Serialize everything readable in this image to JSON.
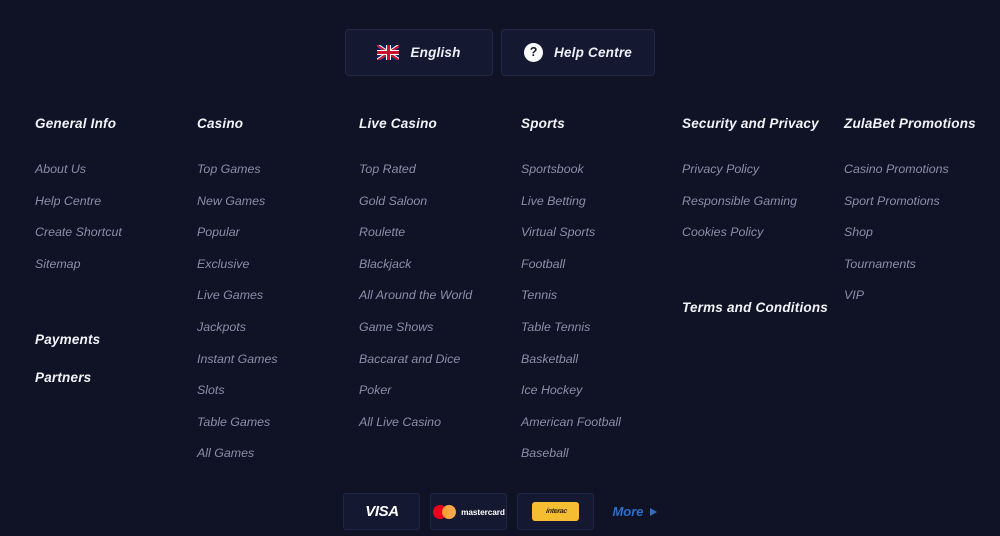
{
  "colors": {
    "background": "#101226",
    "panel": "#151831",
    "border": "#242845",
    "heading_text": "#f3f4f9",
    "link_text": "#8a8fa9",
    "accent_blue": "#2d6fc4",
    "gold": "#F5BE32"
  },
  "top_bar": {
    "language_button": {
      "label": "English",
      "icon": "uk-flag-icon"
    },
    "help_button": {
      "label": "Help Centre",
      "icon": "question-mark-icon"
    }
  },
  "columns": [
    {
      "heading": "General Info",
      "links": [
        "About Us",
        "Help Centre",
        "Create Shortcut",
        "Sitemap"
      ]
    },
    {
      "heading": "Casino",
      "links": [
        "Top Games",
        "New Games",
        "Popular",
        "Exclusive",
        "Live Games",
        "Jackpots",
        "Instant Games",
        "Slots",
        "Table Games",
        "All Games"
      ]
    },
    {
      "heading": "Live Casino",
      "links": [
        "Top Rated",
        "Gold Saloon",
        "Roulette",
        "Blackjack",
        "All Around the World",
        "Game Shows",
        "Baccarat and Dice",
        "Poker",
        "All Live Casino"
      ]
    },
    {
      "heading": "Sports",
      "links": [
        "Sportsbook",
        "Live Betting",
        "Virtual Sports",
        "Football",
        "Tennis",
        "Table Tennis",
        "Basketball",
        "Ice Hockey",
        "American Football",
        "Baseball"
      ]
    },
    {
      "heading": "Security and Privacy",
      "links": [
        "Privacy Policy",
        "Responsible Gaming",
        "Cookies Policy"
      ]
    },
    {
      "heading": "ZulaBet Promotions",
      "links": [
        "Casino Promotions",
        "Sport Promotions",
        "Shop",
        "Tournaments",
        "VIP"
      ]
    }
  ],
  "sub_headings": {
    "payments": "Payments",
    "partners": "Partners",
    "terms": "Terms and Conditions"
  },
  "payment_strip": {
    "methods": [
      {
        "name": "visa-logo",
        "label": "VISA"
      },
      {
        "name": "mastercard-logo",
        "label": "mastercard"
      },
      {
        "name": "gold-payment-logo",
        "label": "interac"
      }
    ],
    "more_label": "More"
  }
}
